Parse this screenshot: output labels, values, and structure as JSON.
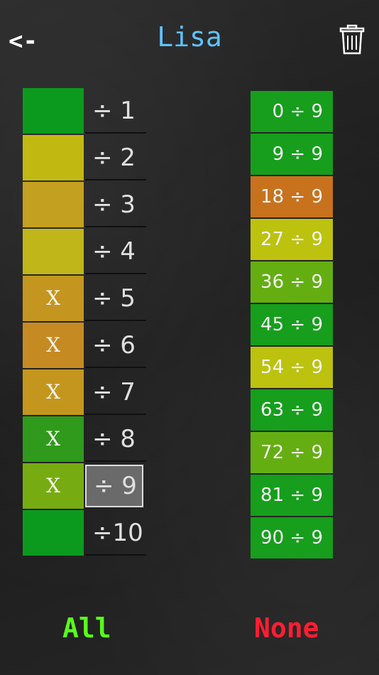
{
  "header": {
    "back_label": "<-",
    "title": "Lisa",
    "trash_icon": "trash-icon"
  },
  "divisors": [
    {
      "label": "÷ 1",
      "mark": "",
      "color": "#0c9a1e",
      "selected": false
    },
    {
      "label": "÷ 2",
      "mark": "",
      "color": "#c2b812",
      "selected": false
    },
    {
      "label": "÷ 3",
      "mark": "",
      "color": "#c4a020",
      "selected": false
    },
    {
      "label": "÷ 4",
      "mark": "",
      "color": "#c0b61a",
      "selected": false
    },
    {
      "label": "÷ 5",
      "mark": "X",
      "color": "#c49620",
      "selected": false
    },
    {
      "label": "÷ 6",
      "mark": "X",
      "color": "#c68a22",
      "selected": false
    },
    {
      "label": "÷ 7",
      "mark": "X",
      "color": "#c4961e",
      "selected": false
    },
    {
      "label": "÷ 8",
      "mark": "X",
      "color": "#2f9a1c",
      "selected": false
    },
    {
      "label": "÷ 9",
      "mark": "X",
      "color": "#76ac12",
      "selected": true
    },
    {
      "label": "÷10",
      "mark": "",
      "color": "#0c9a1e",
      "selected": false
    }
  ],
  "problems": [
    {
      "text": "0 ÷ 9",
      "color": "#169e1c"
    },
    {
      "text": "9 ÷ 9",
      "color": "#169e1c"
    },
    {
      "text": "18 ÷ 9",
      "color": "#c8721e"
    },
    {
      "text": "27 ÷ 9",
      "color": "#bcc20e"
    },
    {
      "text": "36 ÷ 9",
      "color": "#64ae12"
    },
    {
      "text": "45 ÷ 9",
      "color": "#169e1c"
    },
    {
      "text": "54 ÷ 9",
      "color": "#bcc20e"
    },
    {
      "text": "63 ÷ 9",
      "color": "#169e1c"
    },
    {
      "text": "72 ÷ 9",
      "color": "#64ae12"
    },
    {
      "text": "81 ÷ 9",
      "color": "#169e1c"
    },
    {
      "text": "90 ÷ 9",
      "color": "#169e1c"
    }
  ],
  "footer": {
    "all_label": "All",
    "none_label": "None"
  }
}
